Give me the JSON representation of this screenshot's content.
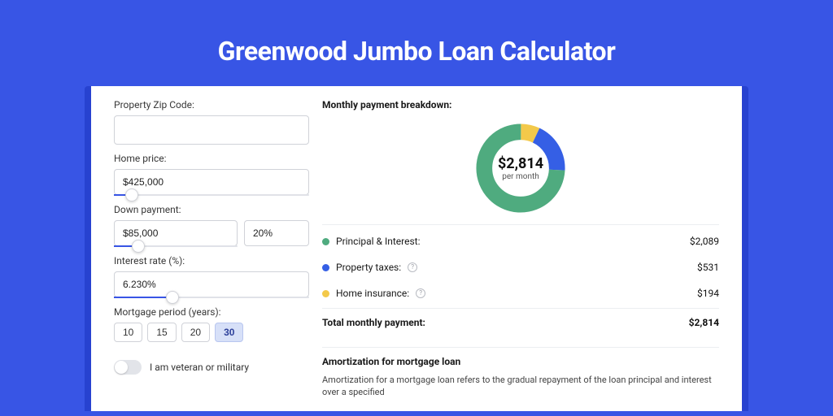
{
  "title": "Greenwood Jumbo Loan Calculator",
  "colors": {
    "principal": "#4fab7f",
    "taxes": "#355fe5",
    "insurance": "#f3c94a"
  },
  "form": {
    "zip": {
      "label": "Property Zip Code:",
      "value": ""
    },
    "home_price": {
      "label": "Home price:",
      "value": "$425,000",
      "slider_pct": 9
    },
    "down_payment": {
      "label": "Down payment:",
      "value_amount": "$85,000",
      "value_pct": "20%",
      "slider_pct": 20
    },
    "interest": {
      "label": "Interest rate (%):",
      "value": "6.230%",
      "slider_pct": 30
    },
    "mortgage_period": {
      "label": "Mortgage period (years):",
      "options": [
        "10",
        "15",
        "20",
        "30"
      ],
      "active": "30"
    },
    "veteran": {
      "label": "I am veteran or military",
      "on": false
    }
  },
  "breakdown": {
    "section_title": "Monthly payment breakdown:",
    "center_amount": "$2,814",
    "center_sub": "per month",
    "items": [
      {
        "key": "principal",
        "label": "Principal & Interest:",
        "value": "$2,089",
        "has_info": false
      },
      {
        "key": "taxes",
        "label": "Property taxes:",
        "value": "$531",
        "has_info": true
      },
      {
        "key": "insurance",
        "label": "Home insurance:",
        "value": "$194",
        "has_info": true
      }
    ],
    "total_label": "Total monthly payment:",
    "total_value": "$2,814"
  },
  "amortization": {
    "title": "Amortization for mortgage loan",
    "text": "Amortization for a mortgage loan refers to the gradual repayment of the loan principal and interest over a specified"
  },
  "chart_data": {
    "type": "pie",
    "title": "Monthly payment breakdown",
    "categories": [
      "Principal & Interest",
      "Property taxes",
      "Home insurance"
    ],
    "values": [
      2089,
      531,
      194
    ],
    "total": 2814
  }
}
